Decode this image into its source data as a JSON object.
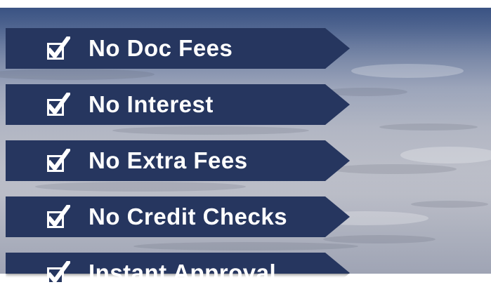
{
  "theme": {
    "banner_color": "#26365f",
    "text_color": "#ffffff",
    "check_icon": "checked-box-icon"
  },
  "benefits": [
    {
      "label": "No Doc Fees"
    },
    {
      "label": "No Interest"
    },
    {
      "label": "No Extra Fees"
    },
    {
      "label": "No Credit Checks"
    },
    {
      "label": "Instant Approval"
    }
  ]
}
